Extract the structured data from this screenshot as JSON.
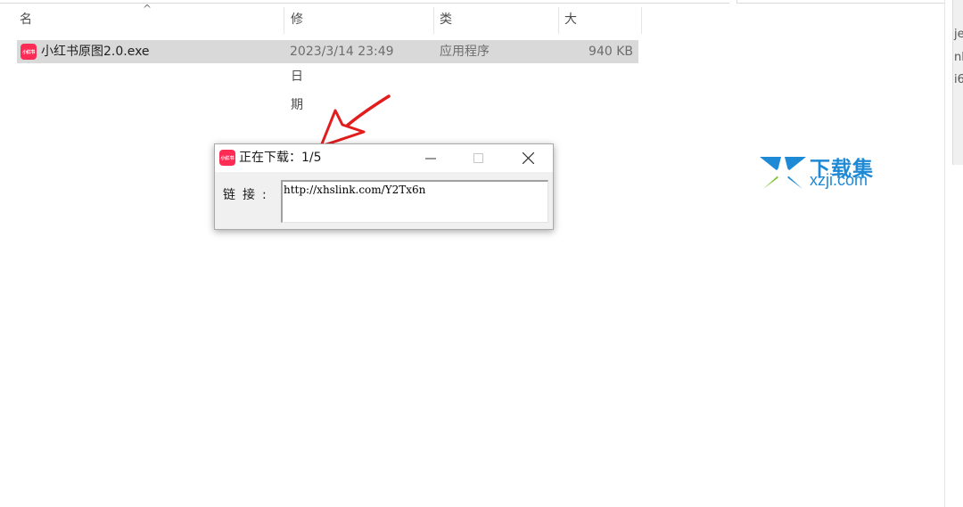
{
  "columns": {
    "name": "名称",
    "date": "修改日期",
    "type": "类型",
    "size": "大小"
  },
  "file": {
    "name": "小红书原图2.0.exe",
    "date": "2023/3/14 23:49",
    "type": "应用程序",
    "size": "940 KB",
    "icon_text": "小红书"
  },
  "dialog": {
    "title": "正在下载：1/5",
    "icon_text": "小红书",
    "link_label": "链接:",
    "link_value": "http://xhslink.com/Y2Tx6n"
  },
  "watermark": {
    "cn": "下载集",
    "en": "xzji.com"
  },
  "clipped_right_text": [
    "je",
    "nl",
    "i6"
  ],
  "colors": {
    "selection": "#d9d9d9",
    "app_icon": "#fe2c55",
    "arrow": "#e11d1d",
    "watermark_blue": "#1e8ad6",
    "watermark_green": "#7cc22b"
  }
}
